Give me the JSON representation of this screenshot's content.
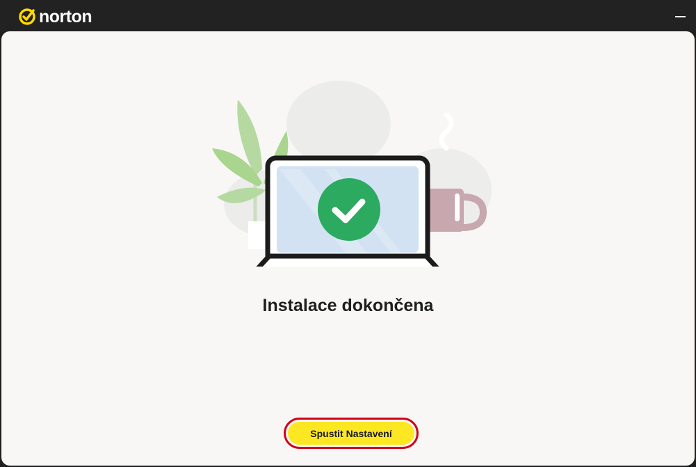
{
  "titlebar": {
    "brand_name": "norton",
    "brand_icon": "norton-checkmark-icon",
    "minimize_icon": "minimize-icon",
    "brand_color": "#FEDA00"
  },
  "main": {
    "illustration": {
      "icons": [
        "laptop-icon",
        "checkmark-icon",
        "plant-icon",
        "coffee-mug-icon"
      ],
      "check_color": "#2BAA60",
      "screen_color": "#D3E2F3",
      "mug_color": "#C8A7AE",
      "leaf_color": "#A9D58E"
    },
    "headline": "Instalace dokončena",
    "button": {
      "label": "Spustit Nastavení",
      "color": "#FDE723",
      "highlight_color": "#D0021B"
    }
  }
}
